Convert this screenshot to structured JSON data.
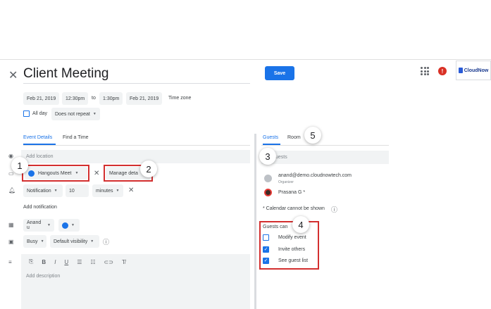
{
  "event": {
    "close_icon": "close-icon",
    "title": "Client Meeting",
    "save_label": "Save"
  },
  "header": {
    "apps_icon": "apps-grid-icon",
    "alert_icon": "alert-icon",
    "alert_glyph": "!",
    "logo_text": "CloudNow"
  },
  "datetime": {
    "start_date": "Feb 21, 2019",
    "start_time": "12:30pm",
    "to_label": "to",
    "end_time": "1:30pm",
    "end_date": "Feb 21, 2019",
    "timezone_label": "Time zone",
    "allday_label": "All day",
    "repeat_value": "Does not repeat"
  },
  "left_tabs": {
    "details": "Event Details",
    "find_time": "Find a Time"
  },
  "details": {
    "location_placeholder": "Add location",
    "conference": "Hangouts Meet",
    "manage_label": "Manage deta",
    "notification_type": "Notification",
    "notification_amount": "10",
    "notification_unit": "minutes",
    "add_notification": "Add notification",
    "calendar_owner": "Anand u",
    "calendar_color": "#1a73e8",
    "busy_value": "Busy",
    "visibility_value": "Default visibility",
    "description_placeholder": "Add description"
  },
  "right_tabs": {
    "guests": "Guests",
    "rooms": "Room"
  },
  "guests": {
    "add_placeholder": "uests",
    "list": [
      {
        "name": "anand@demo.cloudnowtech.com",
        "role": "Organizer"
      },
      {
        "name": "Prasana G *",
        "role": ""
      }
    ],
    "calendar_note": "* Calendar cannot be shown",
    "permissions_title": "Guests can",
    "permissions": [
      {
        "label": "Modify event",
        "checked": false
      },
      {
        "label": "Invite others",
        "checked": true
      },
      {
        "label": "See guest list",
        "checked": true
      }
    ]
  },
  "callouts": [
    "1",
    "2",
    "3",
    "4",
    "5"
  ]
}
